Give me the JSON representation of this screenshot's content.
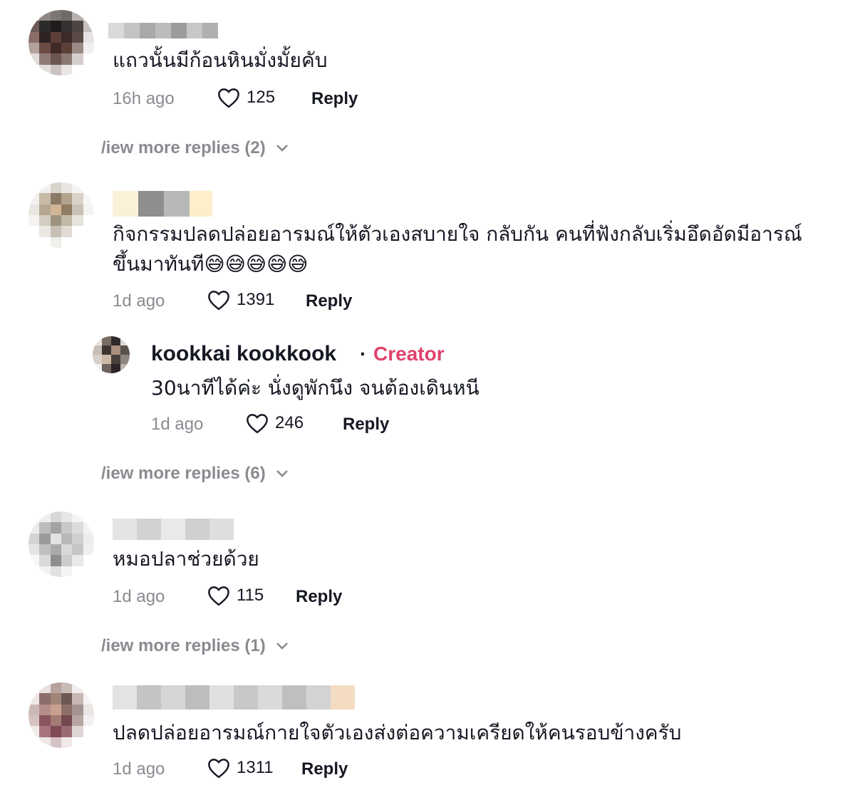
{
  "comments": [
    {
      "text": "แถวนั้นมีก้อนหินมั่งมั้ยคับ",
      "time": "16h ago",
      "likes": "125",
      "reply_label": "Reply",
      "view_more": "/iew more replies (2)"
    },
    {
      "text_line1": "กิจกรรมปลดปล่อยอารมณ์ให้ตัวเองสบายใจ กลับกัน คนที่ฟังกลับเริ่มอึดอัดมีอารณ์",
      "text_line2": "ขึ้นมาทันที😅😅😅😅😅",
      "time": "1d ago",
      "likes": "1391",
      "reply_label": "Reply",
      "creator_reply": {
        "name": "kookkai kookkook",
        "separator": "·",
        "badge": "Creator",
        "text": "30นาทีได้ค่ะ นั่งดูพักนึง จนต้องเดินหนี",
        "time": "1d ago",
        "likes": "246",
        "reply_label": "Reply"
      },
      "view_more": "/iew more replies (6)"
    },
    {
      "text": "หมอปลาช่วยด้วย",
      "time": "1d ago",
      "likes": "115",
      "reply_label": "Reply",
      "view_more": "/iew more replies (1)"
    },
    {
      "text": "ปลดปล่อยอารมณ์กายใจตัวเองส่งต่อความเครียดให้คนรอบข้างครับ",
      "time": "1d ago",
      "likes": "1311",
      "reply_label": "Reply"
    }
  ],
  "icons": {
    "like": "heart-outline-icon",
    "expand": "chevron-down-icon"
  },
  "colors": {
    "creator_badge": "#e0436b",
    "muted_text": "#8a8b91",
    "primary_text": "#161823"
  }
}
